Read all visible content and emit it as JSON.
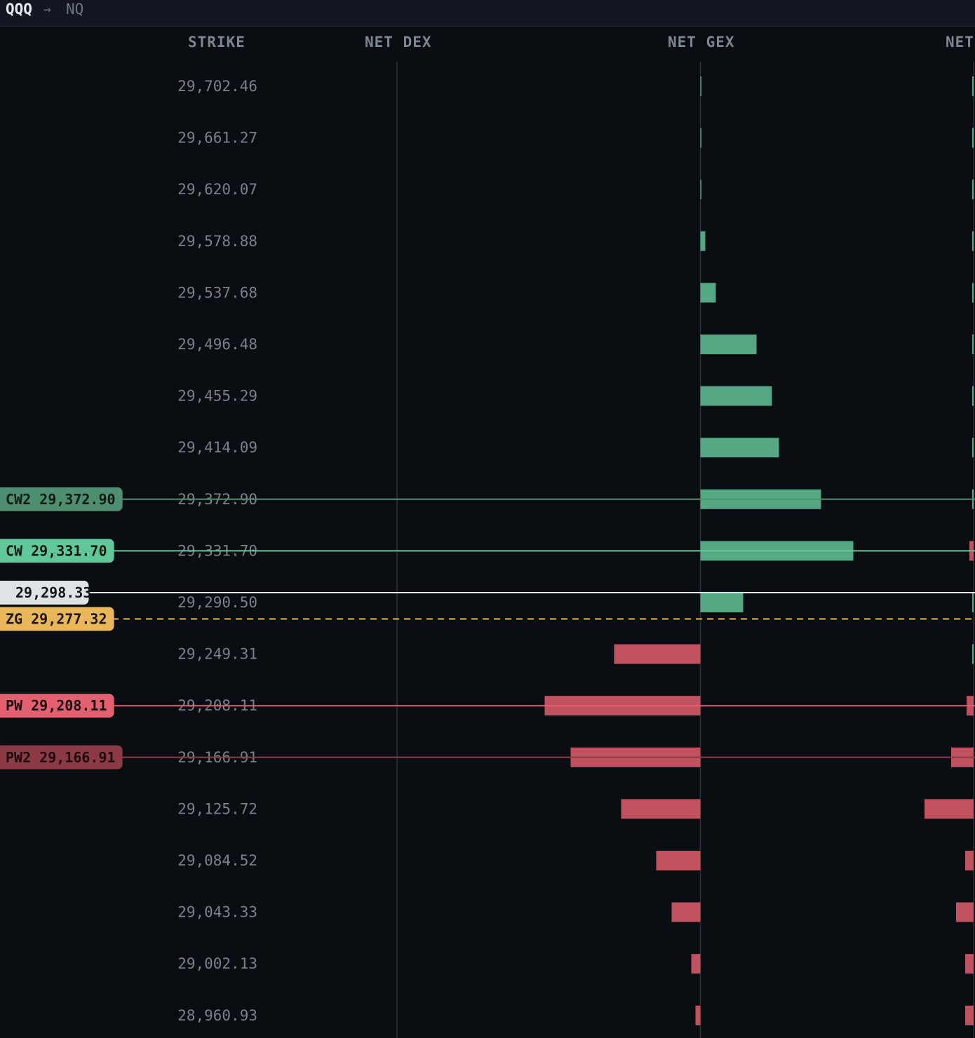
{
  "header": {
    "ticker_from": "QQQ",
    "arrow": "→",
    "ticker_to": "NQ"
  },
  "columns": {
    "strike": "STRIKE",
    "net_dex": "NET DEX",
    "net_gex": "NET GEX",
    "net": "NET"
  },
  "colors": {
    "positive": "#55a883",
    "negative": "#c0525f",
    "background": "#0a0d12",
    "axis": "#2a313b"
  },
  "chart_data": {
    "type": "bar",
    "orientation": "horizontal",
    "categories": [
      "29,702.46",
      "29,661.27",
      "29,620.07",
      "29,578.88",
      "29,537.68",
      "29,496.48",
      "29,455.29",
      "29,414.09",
      "29,372.90",
      "29,331.70",
      "29,290.50",
      "29,249.31",
      "29,208.11",
      "29,166.91",
      "29,125.72",
      "29,084.52",
      "29,043.33",
      "29,002.13",
      "28,960.93"
    ],
    "strikes": [
      29702.46,
      29661.27,
      29620.07,
      29578.88,
      29537.68,
      29496.48,
      29455.29,
      29414.09,
      29372.9,
      29331.7,
      29290.5,
      29249.31,
      29208.11,
      29166.91,
      29125.72,
      29084.52,
      29043.33,
      29002.13,
      28960.93
    ],
    "series": [
      {
        "key": "net_gex",
        "values": [
          1,
          1,
          1,
          7,
          22,
          80,
          102,
          112,
          172,
          218,
          61,
          -123,
          -222,
          -185,
          -113,
          -63,
          -41,
          -13,
          -7
        ]
      },
      {
        "key": "net",
        "values": [
          2,
          2,
          2,
          2,
          2,
          2,
          2,
          2,
          2,
          -6,
          2,
          2,
          -10,
          -32,
          -70,
          -12,
          -25,
          -12,
          -12
        ]
      }
    ],
    "levels": [
      {
        "label": "CW2",
        "value": "29,372.90",
        "strike": 29372.9,
        "color": "#4d8f70",
        "text_color": "#0f1c16",
        "line": "solid"
      },
      {
        "label": "CW",
        "value": "29,331.70",
        "strike": 29331.7,
        "color": "#62c79a",
        "text_color": "#0d1a14",
        "line": "solid"
      },
      {
        "label": "",
        "value": "29,298.33",
        "strike": 29298.33,
        "color": "#dfe3e8",
        "text_color": "#111418",
        "line": "solid"
      },
      {
        "label": "ZG",
        "value": "29,277.32",
        "strike": 29277.32,
        "color": "#e9b75a",
        "text_color": "#1e1608",
        "line": "dashed"
      },
      {
        "label": "PW",
        "value": "29,208.11",
        "strike": 29208.11,
        "color": "#e2606f",
        "text_color": "#1e0a0d",
        "line": "solid"
      },
      {
        "label": "PW2",
        "value": "29,166.91",
        "strike": 29166.91,
        "color": "#8c3a45",
        "text_color": "#1e0a0d",
        "line": "solid"
      }
    ]
  }
}
